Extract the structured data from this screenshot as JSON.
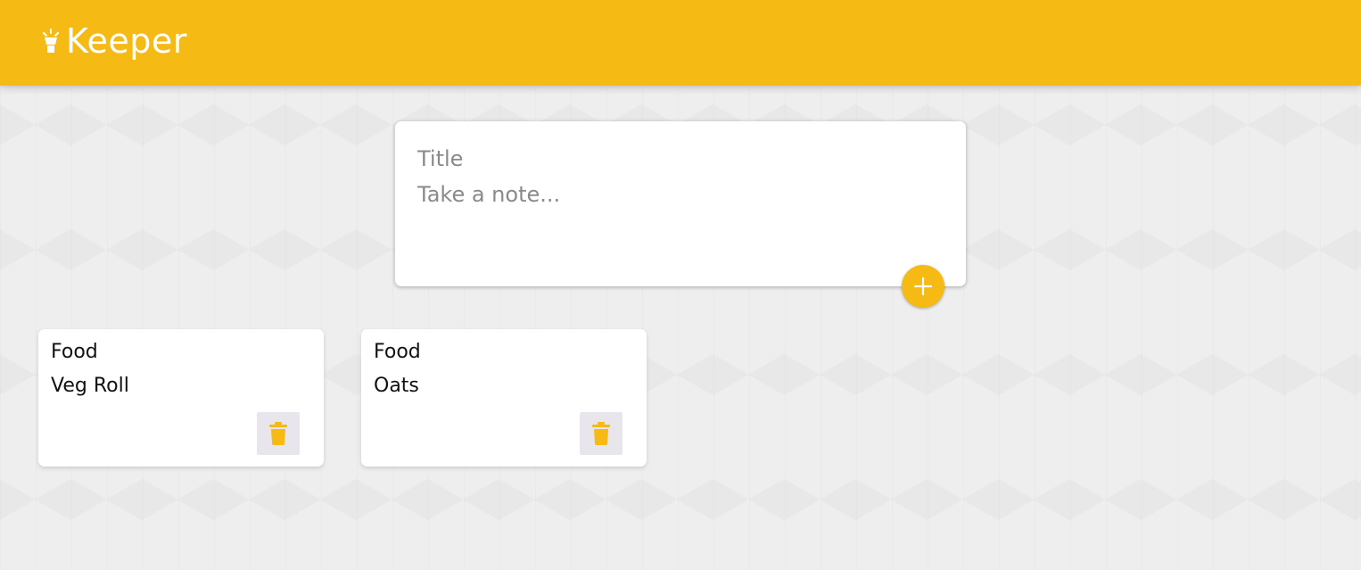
{
  "header": {
    "app_name": "Keeper",
    "logo_icon": "lightbulb-icon",
    "background_color": "#f5ba13"
  },
  "create_note": {
    "title_placeholder": "Title",
    "content_placeholder": "Take a note...",
    "add_icon": "plus-icon"
  },
  "notes": [
    {
      "title": "Food",
      "content": "Veg Roll",
      "delete_icon": "trash-icon"
    },
    {
      "title": "Food",
      "content": "Oats",
      "delete_icon": "trash-icon"
    }
  ],
  "colors": {
    "accent": "#f5ba13",
    "background": "#eeeeee",
    "card": "#ffffff"
  }
}
